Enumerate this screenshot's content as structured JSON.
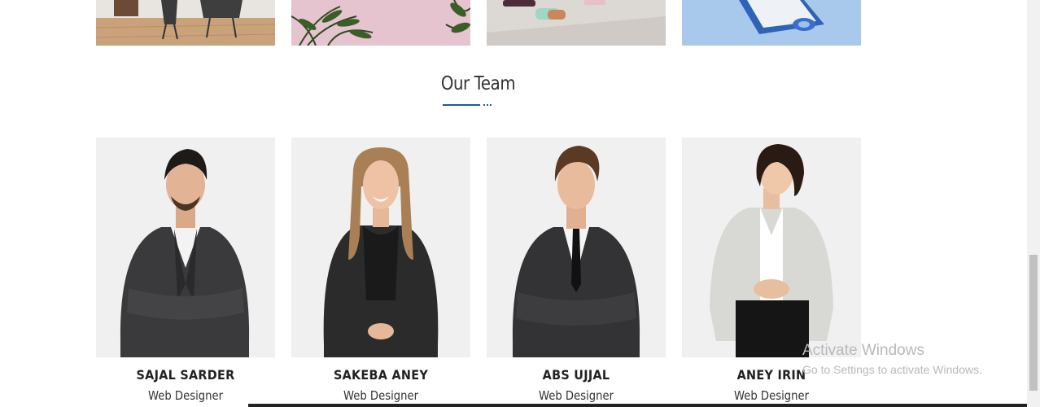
{
  "gallery": {
    "items": [
      {
        "alt": "interior-photo"
      },
      {
        "alt": "plant-photo"
      },
      {
        "alt": "desk-objects-photo"
      },
      {
        "alt": "blue-objects-photo"
      }
    ]
  },
  "team_section": {
    "title": "Our Team",
    "accent_color": "#1d5a8a",
    "members": [
      {
        "name": "SAJAL SARDER",
        "role": "Web Designer"
      },
      {
        "name": "SAKEBA ANEY",
        "role": "Web Designer"
      },
      {
        "name": "ABS UJJAL",
        "role": "Web Designer"
      },
      {
        "name": "ANEY IRIN",
        "role": "Web Designer"
      }
    ]
  },
  "os_watermark": {
    "line1": "Activate Windows",
    "line2": "Go to Settings to activate Windows."
  }
}
